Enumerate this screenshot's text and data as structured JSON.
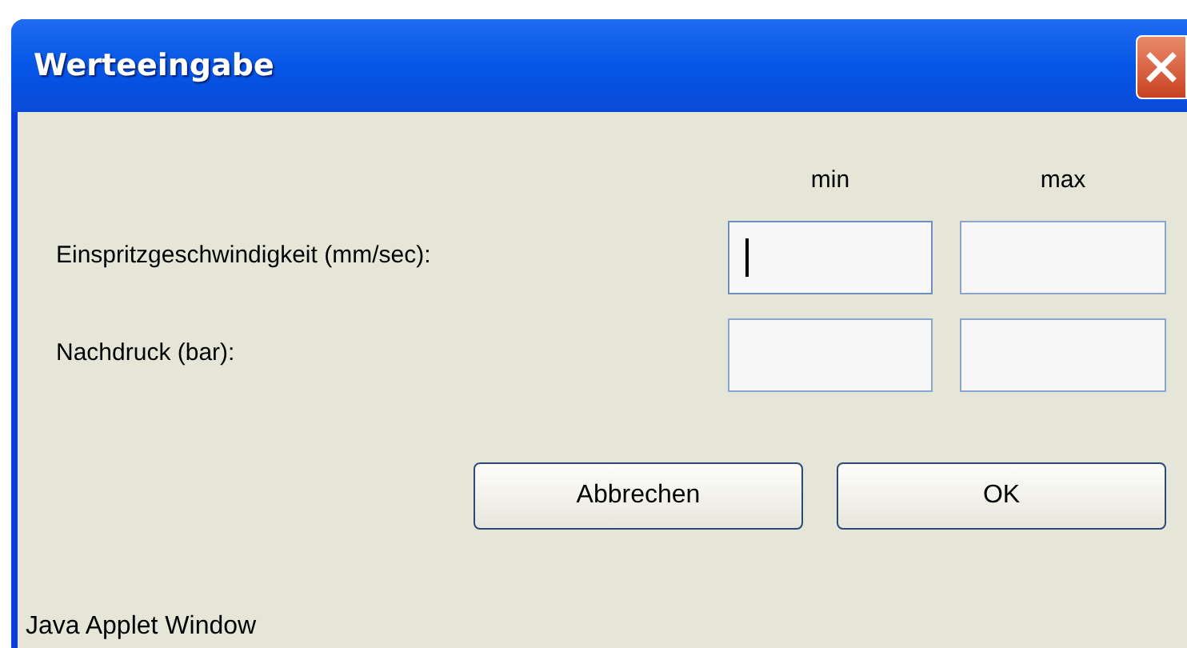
{
  "window": {
    "title": "Werteeingabe"
  },
  "columns": [
    "min",
    "max"
  ],
  "rows": [
    {
      "label": "Einspritzgeschwindigkeit (mm/sec):",
      "fields": [
        {
          "focused": true
        },
        {
          "focused": false
        }
      ]
    },
    {
      "label": "Nachdruck (bar):",
      "fields": [
        {
          "focused": false
        },
        {
          "focused": false
        }
      ]
    }
  ],
  "buttons": [
    "Abbrechen",
    "OK"
  ],
  "status_bar": "Java Applet Window"
}
